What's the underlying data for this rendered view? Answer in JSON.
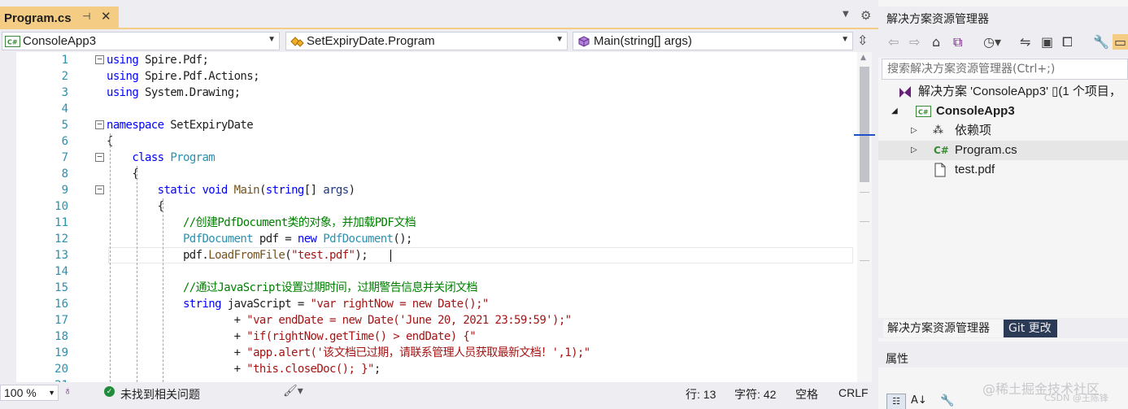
{
  "editor": {
    "tab": {
      "label": "Program.cs",
      "pin": "⊣",
      "close": "✕"
    },
    "nav": {
      "project": {
        "icon": "C#",
        "label": "ConsoleApp3"
      },
      "type": {
        "label": "SetExpiryDate.Program"
      },
      "member": {
        "label": "Main(string[] args)"
      }
    },
    "line_numbers": [
      "1",
      "2",
      "3",
      "4",
      "5",
      "6",
      "7",
      "8",
      "9",
      "10",
      "11",
      "12",
      "13",
      "14",
      "15",
      "16",
      "17",
      "18",
      "19",
      "20",
      "21"
    ],
    "code_lines": [
      [
        {
          "c": "kw",
          "t": "using"
        },
        {
          "c": "pl",
          "t": " Spire.Pdf;"
        }
      ],
      [
        {
          "c": "kw",
          "t": "using"
        },
        {
          "c": "pl",
          "t": " Spire.Pdf.Actions;"
        }
      ],
      [
        {
          "c": "kw",
          "t": "using"
        },
        {
          "c": "pl",
          "t": " System.Drawing;"
        }
      ],
      [],
      [
        {
          "c": "kw",
          "t": "namespace"
        },
        {
          "c": "pl",
          "t": " SetExpiryDate"
        }
      ],
      [
        {
          "c": "pl",
          "t": "{"
        }
      ],
      [
        {
          "c": "pl",
          "t": "    "
        },
        {
          "c": "kw",
          "t": "class"
        },
        {
          "c": "pl",
          "t": " "
        },
        {
          "c": "ty",
          "t": "Program"
        }
      ],
      [
        {
          "c": "pl",
          "t": "    {"
        }
      ],
      [
        {
          "c": "pl",
          "t": "        "
        },
        {
          "c": "kw",
          "t": "static void"
        },
        {
          "c": "pl",
          "t": " "
        },
        {
          "c": "fn",
          "t": "Main"
        },
        {
          "c": "pl",
          "t": "("
        },
        {
          "c": "kw",
          "t": "string"
        },
        {
          "c": "pl",
          "t": "[] "
        },
        {
          "c": "pm",
          "t": "args"
        },
        {
          "c": "pl",
          "t": ")"
        }
      ],
      [
        {
          "c": "pl",
          "t": "        {"
        }
      ],
      [
        {
          "c": "pl",
          "t": "            "
        },
        {
          "c": "cm",
          "t": "//创建PdfDocument类的对象，并加载PDF文档"
        }
      ],
      [
        {
          "c": "pl",
          "t": "            "
        },
        {
          "c": "ty",
          "t": "PdfDocument"
        },
        {
          "c": "pl",
          "t": " pdf = "
        },
        {
          "c": "kw",
          "t": "new"
        },
        {
          "c": "pl",
          "t": " "
        },
        {
          "c": "ty",
          "t": "PdfDocument"
        },
        {
          "c": "pl",
          "t": "();"
        }
      ],
      [
        {
          "c": "pl",
          "t": "            pdf."
        },
        {
          "c": "fn",
          "t": "LoadFromFile"
        },
        {
          "c": "pl",
          "t": "("
        },
        {
          "c": "st",
          "t": "\"test.pdf\""
        },
        {
          "c": "pl",
          "t": ");"
        }
      ],
      [],
      [
        {
          "c": "pl",
          "t": "            "
        },
        {
          "c": "cm",
          "t": "//通过JavaScript设置过期时间，过期警告信息并关闭文档"
        }
      ],
      [
        {
          "c": "pl",
          "t": "            "
        },
        {
          "c": "kw",
          "t": "string"
        },
        {
          "c": "pl",
          "t": " javaScript = "
        },
        {
          "c": "st",
          "t": "\"var rightNow = new Date();\""
        }
      ],
      [
        {
          "c": "pl",
          "t": "                    + "
        },
        {
          "c": "st",
          "t": "\"var endDate = new Date('June 20, 2021 23:59:59');\""
        }
      ],
      [
        {
          "c": "pl",
          "t": "                    + "
        },
        {
          "c": "st",
          "t": "\"if(rightNow.getTime() > endDate) {\""
        }
      ],
      [
        {
          "c": "pl",
          "t": "                    + "
        },
        {
          "c": "st",
          "t": "\"app.alert('该文档已过期，请联系管理人员获取最新文档！',1);\""
        }
      ],
      [
        {
          "c": "pl",
          "t": "                    + "
        },
        {
          "c": "st",
          "t": "\"this.closeDoc(); }\""
        },
        {
          "c": "pl",
          "t": ";"
        }
      ],
      []
    ],
    "folds": [
      "1",
      "5",
      "7",
      "9"
    ]
  },
  "status": {
    "zoom": "100 %",
    "issues": "未找到相关问题",
    "line": "行: 13",
    "char": "字符: 42",
    "space": "空格",
    "eol": "CRLF"
  },
  "solution_explorer": {
    "title": "解决方案资源管理器",
    "search_placeholder": "搜索解决方案资源管理器(Ctrl+;)",
    "tree": {
      "solution": "解决方案 'ConsoleApp3' ▯(1 个项目，",
      "project": "ConsoleApp3",
      "dependencies": "依赖项",
      "program": "Program.cs",
      "pdf": "test.pdf"
    },
    "tabs": {
      "active": "解决方案资源管理器",
      "git": "Git 更改"
    }
  },
  "properties": {
    "title": "属性"
  },
  "watermark": {
    "main": "@稀土掘金技术社区",
    "sub": "CSDN @王陈锋"
  },
  "colors": {
    "tab_accent": "#f5cc84",
    "git_tab": "#2b3a55",
    "splitter": "#1e51c9"
  }
}
